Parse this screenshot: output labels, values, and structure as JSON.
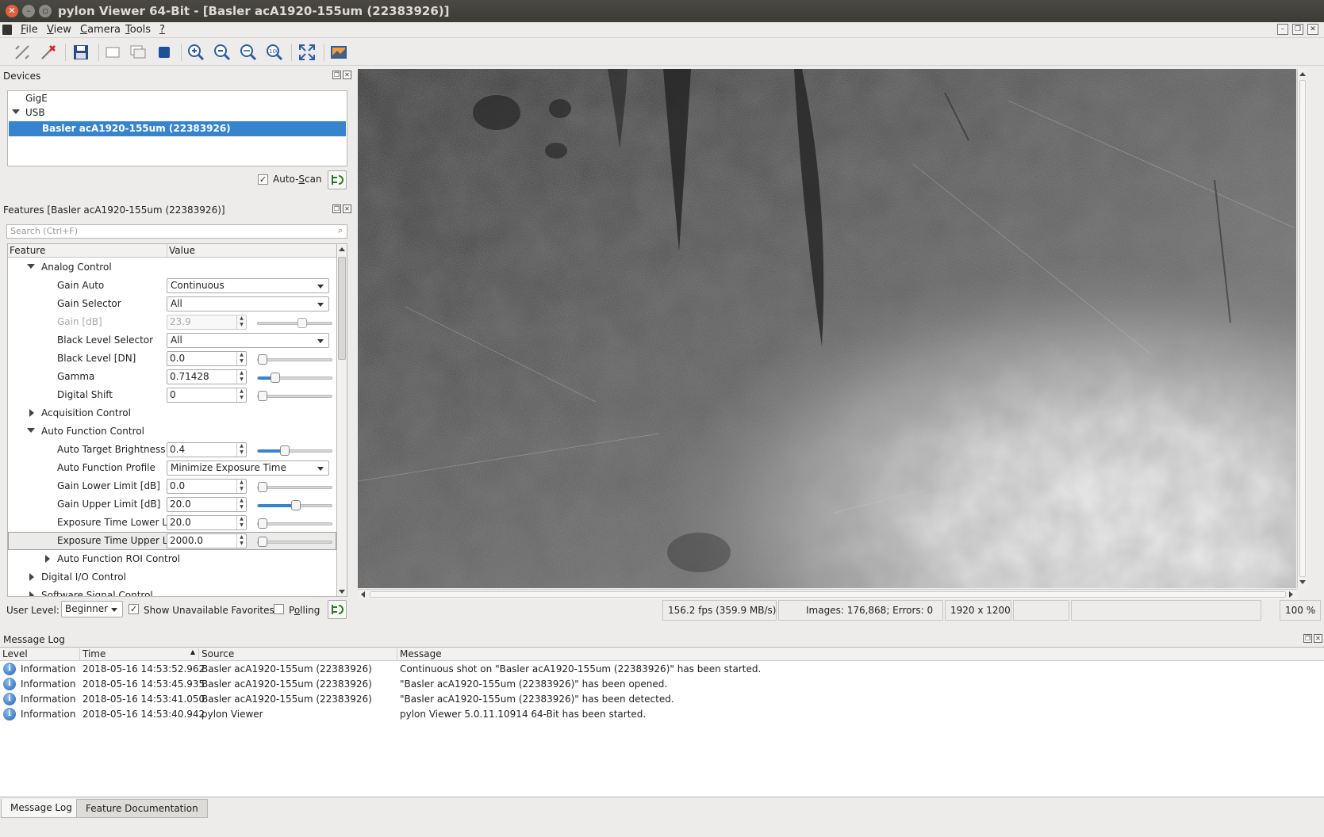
{
  "window": {
    "title": "pylon Viewer 64-Bit - [Basler acA1920-155um (22383926)]"
  },
  "menu": [
    {
      "pre": "",
      "u": "F",
      "post": "ile"
    },
    {
      "pre": "",
      "u": "V",
      "post": "iew"
    },
    {
      "pre": "",
      "u": "C",
      "post": "amera"
    },
    {
      "pre": "",
      "u": "T",
      "post": "ools"
    },
    {
      "pre": "",
      "u": "?",
      "post": ""
    }
  ],
  "devices": {
    "title": "Devices",
    "items": [
      "GigE",
      "USB",
      "Basler acA1920-155um (22383926)"
    ],
    "auto_scan_label_pre": "Auto-",
    "auto_scan_label_u": "S",
    "auto_scan_label_post": "can",
    "auto_scan_checked": "✓"
  },
  "features": {
    "title": "Features [Basler acA1920-155um (22383926)]",
    "search_placeholder": "Search (Ctrl+F)",
    "col_feature": "Feature",
    "col_value": "Value",
    "rows": {
      "analog_control": "Analog Control",
      "gain_auto": {
        "label": "Gain Auto",
        "value": "Continuous"
      },
      "gain_selector": {
        "label": "Gain Selector",
        "value": "All"
      },
      "gain": {
        "label": "Gain [dB]",
        "value": "23.9",
        "level": 0.62
      },
      "black_level_selector": {
        "label": "Black Level Selector",
        "value": "All"
      },
      "black_level": {
        "label": "Black Level [DN]",
        "value": "0.0",
        "level": 0.0
      },
      "gamma": {
        "label": "Gamma",
        "value": "0.71428",
        "level": 0.2
      },
      "digital_shift": {
        "label": "Digital Shift",
        "value": "0",
        "level": 0.0
      },
      "acquisition_control": "Acquisition Control",
      "auto_function_control": "Auto Function Control",
      "auto_target_brightness": {
        "label": "Auto Target Brightness",
        "value": "0.4",
        "level": 0.35
      },
      "auto_function_profile": {
        "label": "Auto Function Profile",
        "value": "Minimize Exposure Time"
      },
      "gain_lower_limit": {
        "label": "Gain Lower Limit [dB]",
        "value": "0.0",
        "level": 0.0
      },
      "gain_upper_limit": {
        "label": "Gain Upper Limit [dB]",
        "value": "20.0",
        "level": 0.52
      },
      "exposure_time_lower": {
        "label": "Exposure Time Lower L...",
        "value": "20.0",
        "level": 0.0
      },
      "exposure_time_upper": {
        "label": "Exposure Time Upper L...",
        "value": "2000.0",
        "level": 0.0
      },
      "auto_function_roi_control": "Auto Function ROI Control",
      "digital_io_control": "Digital I/O Control",
      "software_signal_control": "Software Signal Control"
    },
    "user_level_label": "User Level:",
    "user_level_value": "Beginner",
    "show_unavailable_label": "Show Unavailable Favorites",
    "show_unavailable_checked": "✓",
    "polling_label_pre": "P",
    "polling_label_u": "o",
    "polling_label_post": "lling"
  },
  "status": {
    "fps": "156.2 fps (359.9 MB/s)",
    "images": "Images: 176,868; Errors: 0",
    "resolution": "1920 x 1200",
    "zoom": "100 %"
  },
  "message_log": {
    "title": "Message Log",
    "columns": [
      "Level",
      "Time",
      "Source",
      "Message"
    ],
    "rows": [
      {
        "level": "Information",
        "time": "2018-05-16 14:53:52.962",
        "source": "Basler acA1920-155um (22383926)",
        "message": "Continuous shot on \"Basler acA1920-155um (22383926)\" has been started."
      },
      {
        "level": "Information",
        "time": "2018-05-16 14:53:45.935",
        "source": "Basler acA1920-155um (22383926)",
        "message": "\"Basler acA1920-155um (22383926)\" has been opened."
      },
      {
        "level": "Information",
        "time": "2018-05-16 14:53:41.050",
        "source": "Basler acA1920-155um (22383926)",
        "message": "\"Basler acA1920-155um (22383926)\" has been detected."
      },
      {
        "level": "Information",
        "time": "2018-05-16 14:53:40.942",
        "source": "pylon Viewer",
        "message": "pylon Viewer 5.0.11.10914 64-Bit has been started."
      }
    ]
  },
  "tabs": [
    "Message Log",
    "Feature Documentation"
  ],
  "icons": {
    "close": "close-icon",
    "minimize": "minimize-icon",
    "maximize": "maximize-icon",
    "info": "i"
  },
  "colors": {
    "selection": "#3584cd",
    "titlebar": "#3c3b37",
    "close_button": "#e0603b"
  }
}
